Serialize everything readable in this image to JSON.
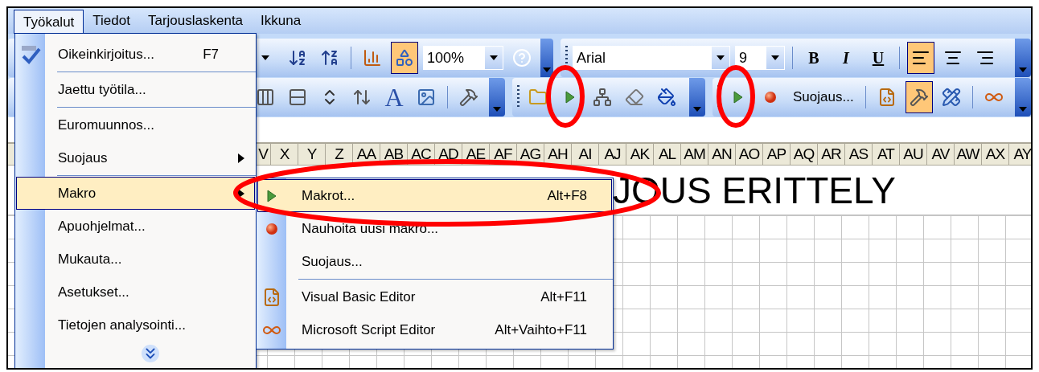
{
  "menubar": [
    {
      "label": "Työkalut",
      "selected": true
    },
    {
      "label": "Tiedot",
      "selected": false
    },
    {
      "label": "Tarjouslaskenta",
      "selected": false
    },
    {
      "label": "Ikkuna",
      "selected": false
    }
  ],
  "toolbar_rows": [
    [
      {
        "items": [
          {
            "kind": "icon",
            "active": false
          },
          {
            "kind": "icon",
            "active": false
          },
          {
            "kind": "icon",
            "active": false
          },
          {
            "kind": "separator"
          },
          {
            "kind": "icon",
            "active": false
          },
          {
            "kind": "icon",
            "active": true
          },
          {
            "kind": "combo",
            "value": "100%"
          },
          {
            "kind": "icon",
            "active": false
          }
        ]
      },
      {
        "items": [
          {
            "kind": "combo",
            "value": "Arial"
          },
          {
            "kind": "combo",
            "value": "9"
          },
          {
            "kind": "separator"
          },
          {
            "kind": "text",
            "label": "B",
            "active": false
          },
          {
            "kind": "text",
            "label": "I",
            "active": false
          },
          {
            "kind": "text",
            "label": "U",
            "active": false
          },
          {
            "kind": "separator"
          },
          {
            "kind": "icon",
            "active": true
          },
          {
            "kind": "icon",
            "active": false
          },
          {
            "kind": "icon",
            "active": false
          }
        ]
      }
    ],
    [
      {
        "items": [
          {
            "kind": "icon",
            "active": false
          },
          {
            "kind": "icon",
            "active": false
          },
          {
            "kind": "icon",
            "active": false
          },
          {
            "kind": "icon",
            "active": false
          },
          {
            "kind": "text",
            "label": "A",
            "active": false
          },
          {
            "kind": "icon",
            "active": false
          },
          {
            "kind": "separator"
          },
          {
            "kind": "icon",
            "active": false
          }
        ]
      },
      {
        "items": [
          {
            "kind": "icon",
            "active": false
          },
          {
            "kind": "icon",
            "active": false
          },
          {
            "kind": "icon",
            "active": false
          },
          {
            "kind": "icon",
            "active": false
          },
          {
            "kind": "icon",
            "active": false
          }
        ]
      },
      {
        "items": [
          {
            "kind": "icon",
            "active": false
          },
          {
            "kind": "icon",
            "active": false
          },
          {
            "kind": "text",
            "label": "Suojaus...",
            "active": false
          },
          {
            "kind": "separator"
          },
          {
            "kind": "icon",
            "active": false
          },
          {
            "kind": "icon",
            "active": true
          },
          {
            "kind": "icon",
            "active": false
          },
          {
            "kind": "separator"
          },
          {
            "kind": "icon",
            "active": false
          }
        ]
      }
    ]
  ],
  "columns": [
    "V",
    "X",
    "Y",
    "Z",
    "AA",
    "AB",
    "AC",
    "AD",
    "AE",
    "AF",
    "AG",
    "AH",
    "AI",
    "AJ",
    "AK",
    "AL",
    "AM",
    "AN",
    "AO",
    "AP",
    "AQ",
    "AR",
    "AS",
    "AT",
    "AU",
    "AV",
    "AW",
    "AX",
    "AY"
  ],
  "sheet": {
    "title": "JOUS ERITTELY"
  },
  "menu": {
    "items": [
      {
        "kind": "item",
        "label": "Oikeinkirjoitus...",
        "shortcut": "F7",
        "selected": false,
        "submenu": false
      },
      {
        "kind": "separator"
      },
      {
        "kind": "item",
        "label": "Jaettu työtila...",
        "selected": false,
        "submenu": false
      },
      {
        "kind": "separator"
      },
      {
        "kind": "item",
        "label": "Euromuunnos...",
        "selected": false,
        "submenu": false
      },
      {
        "kind": "item",
        "label": "Suojaus",
        "selected": false,
        "submenu": true
      },
      {
        "kind": "separator"
      },
      {
        "kind": "item",
        "label": "Makro",
        "selected": true,
        "submenu": true
      },
      {
        "kind": "item",
        "label": "Apuohjelmat...",
        "selected": false,
        "submenu": false
      },
      {
        "kind": "item",
        "label": "Mukauta...",
        "selected": false,
        "submenu": false
      },
      {
        "kind": "item",
        "label": "Asetukset...",
        "selected": false,
        "submenu": false
      },
      {
        "kind": "item",
        "label": "Tietojen analysointi...",
        "selected": false,
        "submenu": false
      },
      {
        "kind": "more"
      }
    ]
  },
  "submenu": {
    "items": [
      {
        "kind": "item",
        "label": "Makrot...",
        "shortcut": "Alt+F8",
        "selected": true
      },
      {
        "kind": "item",
        "label": "Nauhoita uusi makro...",
        "selected": false
      },
      {
        "kind": "item",
        "label": "Suojaus...",
        "selected": false
      },
      {
        "kind": "separator"
      },
      {
        "kind": "item",
        "label": "Visual Basic Editor",
        "shortcut": "Alt+F11",
        "selected": false
      },
      {
        "kind": "item",
        "label": "Microsoft Script Editor",
        "shortcut": "Alt+Vaihto+F11",
        "selected": false
      }
    ]
  }
}
